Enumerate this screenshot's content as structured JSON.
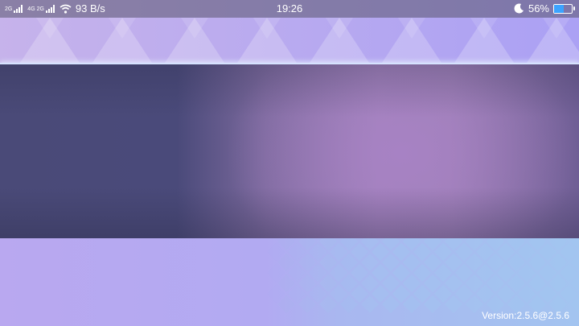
{
  "status_bar": {
    "signal_1": "2G",
    "signal_2": "4G 2G",
    "net_speed": "93 B/s",
    "time": "19:26",
    "battery_percent": "56%",
    "battery_level": 0.56,
    "icons": [
      "signal-icon",
      "signal-icon",
      "wifi-icon",
      "moon-icon",
      "battery-icon"
    ]
  },
  "footer": {
    "version": "Version:2.5.6@2.5.6"
  },
  "colors": {
    "banner_dark": "#4a4a78",
    "banner_light": "#a082b9",
    "accent_line": "#d6e2ff",
    "battery": "#3ba3ff"
  }
}
